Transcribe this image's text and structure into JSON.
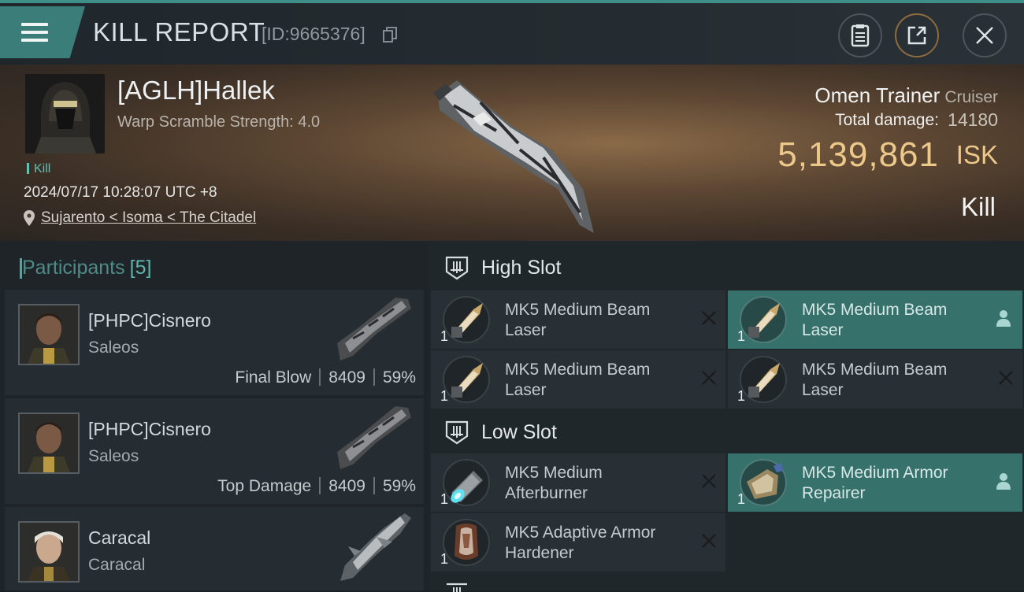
{
  "header": {
    "title": "KILL REPORT",
    "report_id": "[ID:9665376]"
  },
  "victim": {
    "name": "[AGLH]Hallek",
    "warp_scramble": "Warp Scramble Strength: 4.0",
    "kill_tag": "Kill",
    "datetime": "2024/07/17 10:28:07 UTC +8",
    "location": "Sujarento < Isoma < The Citadel",
    "ship_name": "Omen Trainer",
    "ship_class": "Cruiser",
    "total_damage_label": "Total damage:",
    "total_damage": "14180",
    "isk_value": "5,139,861",
    "isk_unit": "ISK",
    "result": "Kill"
  },
  "participants": {
    "label": "Participants",
    "count": "[5]",
    "items": [
      {
        "name": "[PHPC]Cisnero",
        "ship": "Saleos",
        "role": "Final Blow",
        "damage": "8409",
        "percent": "59%"
      },
      {
        "name": "[PHPC]Cisnero",
        "ship": "Saleos",
        "role": "Top Damage",
        "damage": "8409",
        "percent": "59%"
      },
      {
        "name": "Caracal",
        "ship": "Caracal",
        "role": "",
        "damage": "",
        "percent": ""
      }
    ]
  },
  "fitting": {
    "high_slot": {
      "title": "High Slot",
      "modules": [
        {
          "name": "MK5 Medium Beam Laser",
          "qty": "1",
          "status": "destroyed"
        },
        {
          "name": "MK5 Medium Beam Laser",
          "qty": "1",
          "status": "dropped"
        },
        {
          "name": "MK5 Medium Beam Laser",
          "qty": "1",
          "status": "destroyed"
        },
        {
          "name": "MK5 Medium Beam Laser",
          "qty": "1",
          "status": "destroyed"
        }
      ]
    },
    "low_slot": {
      "title": "Low Slot",
      "modules": [
        {
          "name": "MK5 Medium Afterburner",
          "qty": "1",
          "status": "destroyed"
        },
        {
          "name": "MK5 Medium Armor Repairer",
          "qty": "1",
          "status": "dropped"
        },
        {
          "name": "MK5 Adaptive Armor Hardener",
          "qty": "1",
          "status": "destroyed"
        }
      ]
    }
  },
  "colors": {
    "accent": "#3b7e79",
    "isk": "#ecc88a",
    "highlight": "#37716c"
  },
  "icons": [
    "menu-icon",
    "copy-icon",
    "clipboard-icon",
    "share-icon",
    "close-icon",
    "location-pin-icon",
    "slot-icon",
    "destroyed-x-icon",
    "pilot-icon"
  ]
}
